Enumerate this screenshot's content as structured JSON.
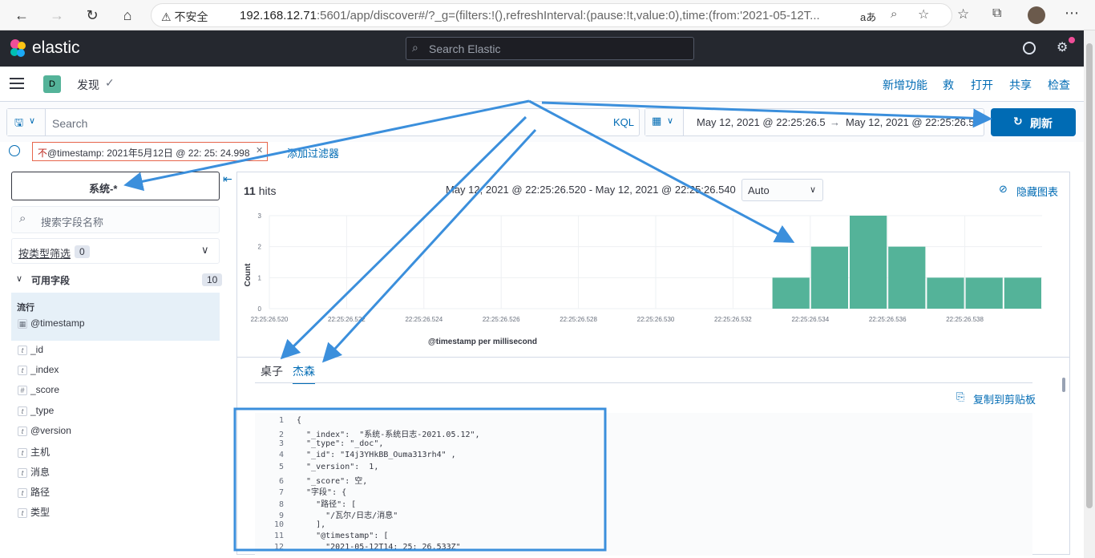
{
  "browser": {
    "security_label": "不安全",
    "url_host": "192.168.12.71",
    "url_rest": ":5601/app/discover#/?_g=(filters:!(),refreshInterval:(pause:!t,value:0),time:(from:'2021-05-12T..."
  },
  "header": {
    "logo_text": "elastic",
    "search_placeholder": "Search Elastic"
  },
  "breadcrumb": {
    "space_badge": "D",
    "app_name": "发现"
  },
  "top_nav": [
    "新增功能",
    "救",
    "打开",
    "共享",
    "检查"
  ],
  "query": {
    "placeholder": "Search",
    "kql": "KQL",
    "date_from": "May 12, 2021 @ 22:25:26.5",
    "date_arrow": "→",
    "date_to": "May 12, 2021 @ 22:25:26.5",
    "refresh_label": "刷新"
  },
  "filter": {
    "pill_prefix": "不",
    "pill_text": "@timestamp:  2021年5月12日 @ 22: 25: 24.998",
    "add_label": "添加过滤器"
  },
  "sidebar": {
    "index_pattern": "系统-*",
    "field_search_placeholder": "搜索字段名称",
    "type_filter_label": "按类型筛选",
    "type_filter_count": "0",
    "available_label": "可用字段",
    "available_count": "10",
    "popular_label": "流行",
    "popular_field": "@timestamp",
    "fields": [
      {
        "type": "t",
        "name": "_id"
      },
      {
        "type": "t",
        "name": "_index"
      },
      {
        "type": "#",
        "name": "_score"
      },
      {
        "type": "t",
        "name": "_type"
      },
      {
        "type": "t",
        "name": "@version"
      },
      {
        "type": "t",
        "name": "主机"
      },
      {
        "type": "t",
        "name": "消息"
      },
      {
        "type": "t",
        "name": "路径"
      },
      {
        "type": "t",
        "name": "类型"
      }
    ]
  },
  "main": {
    "hits_count": "11",
    "hits_label": "hits",
    "time_range": "May 12, 2021 @ 22:25:26.520 - May 12, 2021 @ 22:25:26.540",
    "interval": "Auto",
    "hide_chart": "隐藏图表",
    "tabs": [
      "桌子",
      "杰森"
    ],
    "copy_label": "复制到剪贴板"
  },
  "chart_data": {
    "type": "bar",
    "title": "",
    "xlabel": "@timestamp per millisecond",
    "ylabel": "Count",
    "ylim": [
      0,
      3
    ],
    "y_ticks": [
      "0",
      "1",
      "2",
      "3"
    ],
    "x_tick_labels": [
      "22:25:26.520",
      "22:25:26.522",
      "22:25:26.524",
      "22:25:26.526",
      "22:25:26.528",
      "22:25:26.530",
      "22:25:26.532",
      "22:25:26.534",
      "22:25:26.536",
      "22:25:26.538"
    ],
    "x_domain": [
      0,
      20
    ],
    "bars": [
      {
        "x": 13,
        "value": 1
      },
      {
        "x": 14,
        "value": 2
      },
      {
        "x": 15,
        "value": 3
      },
      {
        "x": 16,
        "value": 2
      },
      {
        "x": 17,
        "value": 1
      },
      {
        "x": 18,
        "value": 1
      },
      {
        "x": 19,
        "value": 1
      }
    ],
    "bar_color": "#54b399",
    "grid": true
  },
  "json_lines": [
    {
      "n": "1",
      "text": "{"
    },
    {
      "n": "2",
      "text": "  \"_index\":  \"系统-系统日志-2021.05.12\","
    },
    {
      "n": "3",
      "text": "  \"_type\": \"_doc\","
    },
    {
      "n": "4",
      "text": "  \"_id\": \"I4j3YHkBB_Ouma313rh4\" ,"
    },
    {
      "n": "5",
      "text": "  \"_version\":  1,"
    },
    {
      "n": "6",
      "text": "  \"_score\": 空,"
    },
    {
      "n": "7",
      "text": "  \"字段\": {"
    },
    {
      "n": "8",
      "text": "    \"路径\": ["
    },
    {
      "n": "9",
      "text": "      \"/瓦尔/日志/消息\""
    },
    {
      "n": "10",
      "text": "    ],"
    },
    {
      "n": "11",
      "text": "    \"@timestamp\": ["
    },
    {
      "n": "12",
      "text": "      \"2021-05-12T14: 25: 26.533Z\""
    }
  ],
  "colors": {
    "accent": "#006bb4",
    "annotation": "#3b8fdc",
    "bar": "#54b399",
    "filter_border": "#e7664c"
  }
}
